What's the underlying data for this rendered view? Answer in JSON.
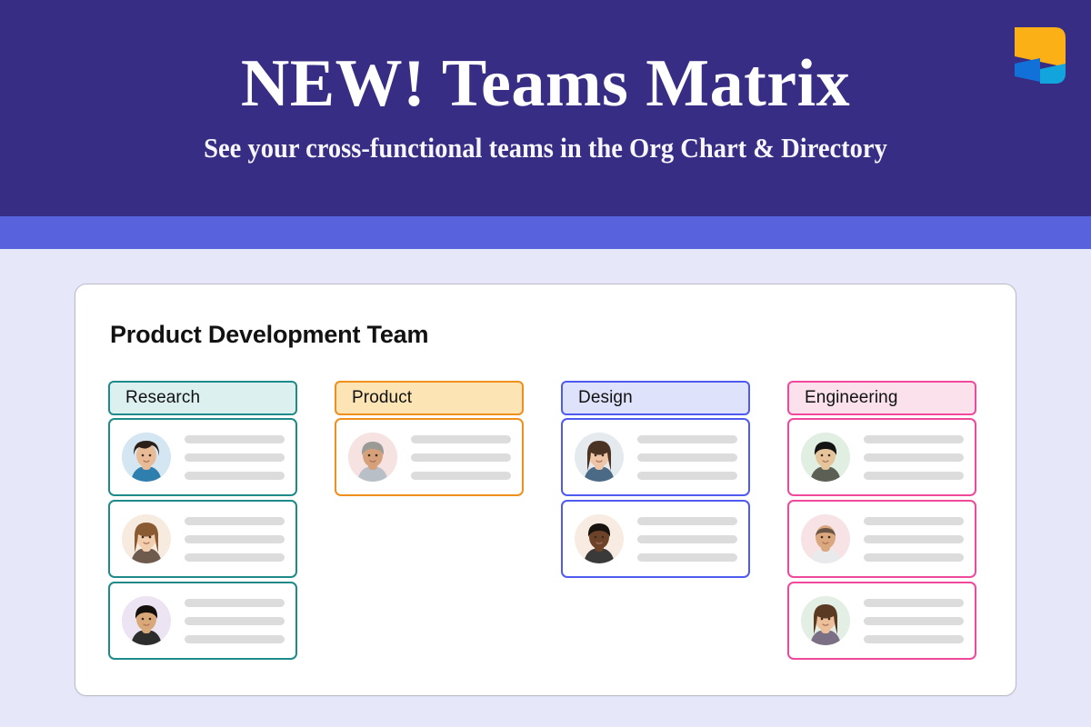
{
  "hero": {
    "title": "NEW! Teams Matrix",
    "subtitle": "See your cross-functional teams in the Org Chart & Directory",
    "background_color": "#372d84",
    "accent_stripe_color": "#5862dd",
    "logo_name": "company-logo",
    "logo_colors": {
      "top": "#fbb116",
      "bottom_left": "#1271d8",
      "bottom_right": "#12a5dd"
    }
  },
  "page": {
    "background_color": "#e6e8fa"
  },
  "board": {
    "title": "Product Development Team",
    "columns": [
      {
        "name": "Research",
        "header_fill": "#ddf0f0",
        "header_border": "#1e8a8a",
        "card_border": "#1e8a8a",
        "members": [
          {
            "avatar_name": "avatar-research-1",
            "avatar_bg": "#d3e6f2",
            "skeleton_widths": [
              "100%",
              "100%",
              "100%"
            ]
          },
          {
            "avatar_name": "avatar-research-2",
            "avatar_bg": "#f7ebe0",
            "skeleton_widths": [
              "100%",
              "100%",
              "100%"
            ]
          },
          {
            "avatar_name": "avatar-research-3",
            "avatar_bg": "#ece4f2",
            "skeleton_widths": [
              "100%",
              "100%",
              "100%"
            ]
          }
        ]
      },
      {
        "name": "Product",
        "header_fill": "#fde4b4",
        "header_border": "#ef8f1c",
        "card_border": "#ef8f1c",
        "members": [
          {
            "avatar_name": "avatar-product-1",
            "avatar_bg": "#f7e2e2",
            "skeleton_widths": [
              "100%",
              "100%",
              "100%"
            ]
          }
        ]
      },
      {
        "name": "Design",
        "header_fill": "#dfe2fb",
        "header_border": "#4f5bef",
        "card_border": "#4f5bef",
        "members": [
          {
            "avatar_name": "avatar-design-1",
            "avatar_bg": "#e4eaee",
            "skeleton_widths": [
              "100%",
              "100%",
              "100%"
            ]
          },
          {
            "avatar_name": "avatar-design-2",
            "avatar_bg": "#f8ece2",
            "skeleton_widths": [
              "100%",
              "100%",
              "100%"
            ]
          }
        ]
      },
      {
        "name": "Engineering",
        "header_fill": "#fbe1ec",
        "header_border": "#f0489b",
        "card_border": "#f0489b",
        "members": [
          {
            "avatar_name": "avatar-engineering-1",
            "avatar_bg": "#e1efe3",
            "skeleton_widths": [
              "100%",
              "100%",
              "100%"
            ]
          },
          {
            "avatar_name": "avatar-engineering-2",
            "avatar_bg": "#f7e3e6",
            "skeleton_widths": [
              "100%",
              "100%",
              "100%"
            ]
          },
          {
            "avatar_name": "avatar-engineering-3",
            "avatar_bg": "#e3efe4",
            "skeleton_widths": [
              "100%",
              "100%",
              "100%"
            ]
          }
        ]
      }
    ]
  }
}
